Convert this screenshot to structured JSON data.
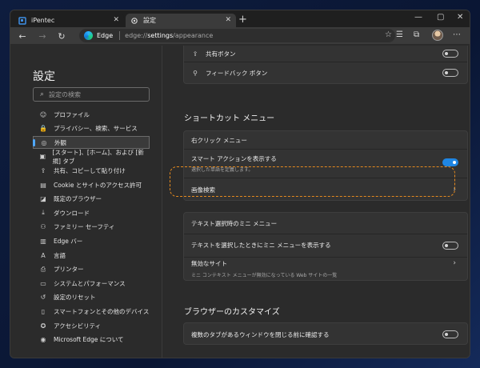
{
  "tabs": [
    {
      "title": "iPentec",
      "close": "✕"
    },
    {
      "title": "設定",
      "close": "✕"
    }
  ],
  "new_tab": "+",
  "window_controls": {
    "minimize": "—",
    "maximize": "▢",
    "close": "✕"
  },
  "address_bar": {
    "brand": "Edge",
    "url_prefix": "edge://",
    "url_main": "settings",
    "url_suffix": "/appearance"
  },
  "sidebar": {
    "title": "設定",
    "search_placeholder": "設定の検索",
    "items": [
      {
        "label": "プロファイル",
        "icon": "profile-icon",
        "glyph": "☺"
      },
      {
        "label": "プライバシー、検索、サービス",
        "icon": "lock-icon",
        "glyph": "🔒"
      },
      {
        "label": "外観",
        "icon": "palette-icon",
        "glyph": "◎",
        "selected": true
      },
      {
        "label": "[スタート]、[ホーム]、および [新規] タブ",
        "icon": "tab-icon",
        "glyph": "▣"
      },
      {
        "label": "共有、コピーして貼り付け",
        "icon": "share-icon",
        "glyph": "⇪"
      },
      {
        "label": "Cookie とサイトのアクセス許可",
        "icon": "cookie-icon",
        "glyph": "▤"
      },
      {
        "label": "既定のブラウザー",
        "icon": "browser-icon",
        "glyph": "◪"
      },
      {
        "label": "ダウンロード",
        "icon": "download-icon",
        "glyph": "⤓"
      },
      {
        "label": "ファミリー セーフティ",
        "icon": "family-icon",
        "glyph": "⚇"
      },
      {
        "label": "Edge バー",
        "icon": "edge-bar-icon",
        "glyph": "▥"
      },
      {
        "label": "言語",
        "icon": "language-icon",
        "glyph": "A"
      },
      {
        "label": "プリンター",
        "icon": "printer-icon",
        "glyph": "⎙"
      },
      {
        "label": "システムとパフォーマンス",
        "icon": "system-icon",
        "glyph": "▭"
      },
      {
        "label": "設定のリセット",
        "icon": "reset-icon",
        "glyph": "↺"
      },
      {
        "label": "スマートフォンとその他のデバイス",
        "icon": "phone-icon",
        "glyph": "▯"
      },
      {
        "label": "アクセシビリティ",
        "icon": "accessibility-icon",
        "glyph": "✪"
      },
      {
        "label": "Microsoft Edge について",
        "icon": "edge-logo-icon",
        "glyph": "◉"
      }
    ]
  },
  "content": {
    "top_card": {
      "rows": [
        {
          "label": "共有ボタン",
          "icon": "share-icon",
          "glyph": "⇪",
          "toggle": false
        },
        {
          "label": "フィードバック ボタン",
          "icon": "feedback-icon",
          "glyph": "⚲",
          "toggle": false
        }
      ]
    },
    "shortcut_section": {
      "title": "ショートカット メニュー",
      "right_click_header": "右クリック メニュー",
      "smart_actions": {
        "label": "スマート アクションを表示する",
        "sub": "選択した単語を定義します。",
        "toggle": true
      },
      "image_search": {
        "label": "画像検索"
      },
      "mini_menu_header": "テキスト選択時のミニ メニュー",
      "mini_menu_toggle": {
        "label": "テキストを選択したときにミニ メニューを表示する",
        "toggle": false
      },
      "disabled_sites": {
        "label": "無効なサイト",
        "sub": "ミニ コンテキスト メニューが無効になっている Web サイトの一覧"
      }
    },
    "browser_section": {
      "title": "ブラウザーのカスタマイズ",
      "confirm_close": {
        "label": "複数のタブがあるウィンドウを閉じる前に確認する",
        "toggle": false
      }
    }
  },
  "colors": {
    "accent": "#1f86e3",
    "highlight": "#e58a1f",
    "background": "#2b2b2b"
  }
}
